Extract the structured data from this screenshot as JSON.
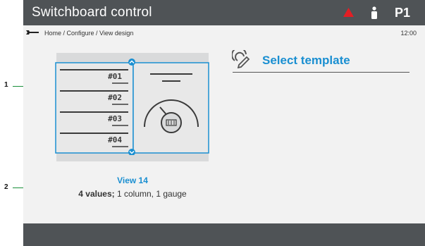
{
  "header": {
    "title": "Switchboard control",
    "page_id": "P1"
  },
  "breadcrumb": {
    "path": "Home / Configure / View design",
    "time": "12:00"
  },
  "preview": {
    "rows": [
      "#01",
      "#02",
      "#03",
      "#04"
    ]
  },
  "template": {
    "label": "Select template"
  },
  "view": {
    "name": "View 14",
    "desc_bold": "4 values;",
    "desc_rest": " 1 column, 1 gauge"
  },
  "callouts": [
    "1",
    "2"
  ],
  "colors": {
    "accent": "#1a8fd1",
    "bar": "#4f5356",
    "alarm": "#e31e24",
    "callout": "#1a8f3a"
  }
}
